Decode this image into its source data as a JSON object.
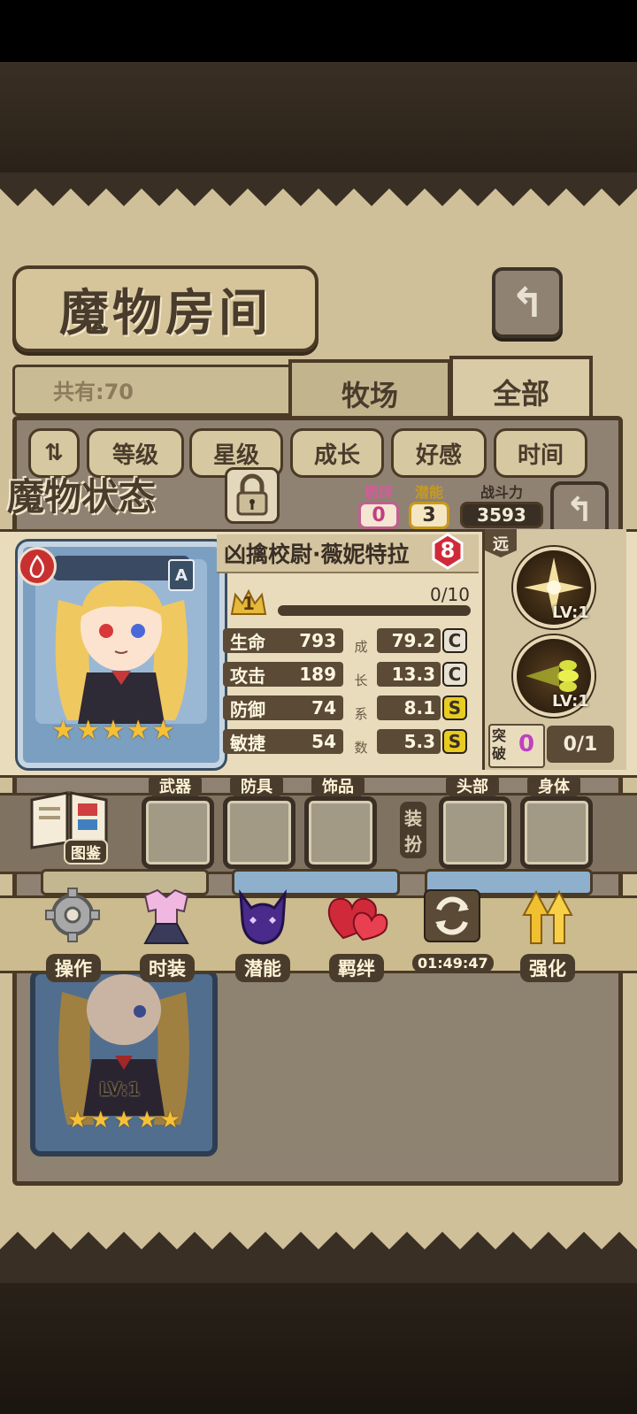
{
  "room": {
    "title": "魔物房间",
    "count_label": "共有:70",
    "tabs": [
      "牧场",
      "全部"
    ],
    "sort_buttons": [
      "等级",
      "星级",
      "成长",
      "好感",
      "时间"
    ]
  },
  "status": {
    "title": "魔物状态",
    "bond": {
      "label": "羁绊",
      "value": "0"
    },
    "potential": {
      "label": "潜能",
      "value": "3"
    },
    "power": {
      "label": "战斗力",
      "value": "3593"
    }
  },
  "monster": {
    "name": "凶擒校尉·薇妮特拉",
    "level_badge": "8",
    "rarity_letter": "A",
    "star_count": 5,
    "exp_level": "1",
    "exp_text": "0/10",
    "exp_fraction": 0.0,
    "growth_vertical_label": [
      "成",
      "长",
      "系",
      "数"
    ],
    "stats": [
      {
        "label": "生命",
        "value": "793",
        "growth": "79.2",
        "grade": "C"
      },
      {
        "label": "攻击",
        "value": "189",
        "growth": "13.3",
        "grade": "C"
      },
      {
        "label": "防御",
        "value": "74",
        "growth": "8.1",
        "grade": "S"
      },
      {
        "label": "敏捷",
        "value": "54",
        "growth": "5.3",
        "grade": "S"
      }
    ],
    "range_tag": "远",
    "skills": [
      {
        "level": "LV:1"
      },
      {
        "level": "LV:1"
      }
    ],
    "breakthrough": {
      "label": [
        "突",
        "破"
      ],
      "count": "0",
      "progress": "0/1"
    }
  },
  "equipment": {
    "book_label": "图鉴",
    "slots": [
      "武器",
      "防具",
      "饰品"
    ],
    "dress_label": [
      "装",
      "扮"
    ],
    "dress_slots": [
      "头部",
      "身体"
    ]
  },
  "actions": [
    {
      "label": "操作",
      "icon": "gear-icon"
    },
    {
      "label": "时装",
      "icon": "outfit-icon"
    },
    {
      "label": "潜能",
      "icon": "demon-icon"
    },
    {
      "label": "羁绊",
      "icon": "hearts-icon"
    },
    {
      "label": "01:49:47",
      "icon": "refresh-icon"
    },
    {
      "label": "强化",
      "icon": "upgrade-arrows-icon"
    }
  ],
  "list_card": {
    "level": "LV:1",
    "star_count": 5
  },
  "colors": {
    "panel": "#e8dcbd",
    "frame": "#4a3a26",
    "bond_pink": "#e080b0",
    "potential_yellow": "#e6b93a",
    "grade_s": "#e8cc20"
  }
}
